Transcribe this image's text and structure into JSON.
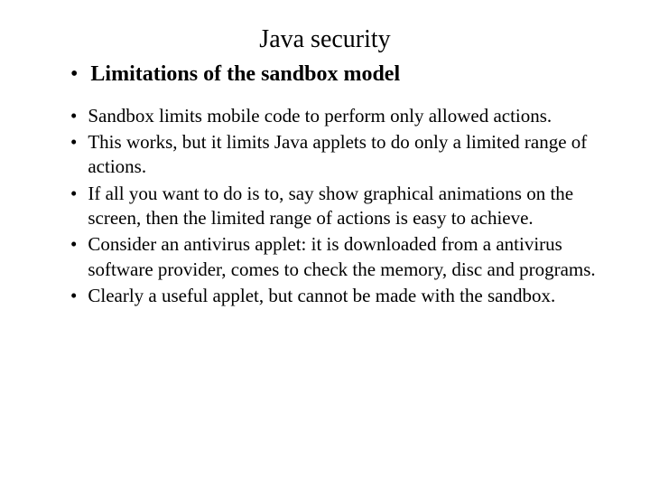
{
  "slide": {
    "title": "Java security",
    "subtitle": "Limitations of the sandbox model",
    "bullets": [
      "Sandbox limits mobile code to perform only allowed actions.",
      "This works, but it limits Java applets to do only a limited range of actions.",
      "If all you want to do is to, say show graphical animations on the screen, then the limited range of actions is easy to achieve.",
      "Consider an antivirus applet: it is downloaded from a antivirus software provider, comes to check the memory, disc and programs.",
      "Clearly a useful applet, but cannot be made with the sandbox."
    ]
  }
}
